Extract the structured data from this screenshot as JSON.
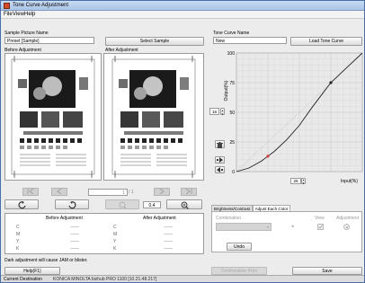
{
  "window": {
    "title": "Tone Curve Adjustment"
  },
  "menu": [
    "File",
    "View",
    "Help"
  ],
  "sample": {
    "label": "Sample Picture Name",
    "value": "Preset [Sample]",
    "select_button": "Select Sample"
  },
  "tonecurve": {
    "label": "Tone Curve Name",
    "value": "New",
    "load_button": "Load Tone Curve"
  },
  "before_label": "Before Adjustment",
  "after_label": "After Adjustment",
  "nav": {
    "page_value": "1",
    "page_total": "/ 1",
    "zoom": "0.4"
  },
  "table": {
    "before_header": "Before Adjustment",
    "after_header": "After Adjustment",
    "channels": [
      "C",
      "M",
      "Y",
      "K"
    ],
    "value": "------"
  },
  "warning": "Dark adjustment will cause JAM or blister.",
  "help_button": "Help(F1)",
  "graph": {
    "y_axis_label": "Output(%)",
    "x_axis_label": "Input(%)",
    "y_ticks": [
      "100",
      "75",
      "50",
      "25",
      "0"
    ],
    "x_ticks": [
      "0",
      "25",
      "50",
      "75",
      "100"
    ],
    "y_spin_value": "16",
    "x_spin_value": "25",
    "curve": [
      [
        0,
        0
      ],
      [
        10,
        3
      ],
      [
        20,
        9
      ],
      [
        25,
        13
      ],
      [
        30,
        17
      ],
      [
        40,
        27
      ],
      [
        50,
        39
      ],
      [
        60,
        54
      ],
      [
        70,
        68
      ],
      [
        75,
        75
      ],
      [
        80,
        80
      ],
      [
        90,
        90
      ],
      [
        100,
        100
      ]
    ],
    "points": [
      {
        "x": 25,
        "y": 13,
        "color": "#d43c3c"
      },
      {
        "x": 75,
        "y": 75,
        "color": "#222222"
      }
    ]
  },
  "adjust": {
    "tabs": [
      "Brightness/Contrast",
      "Adjust Each Color"
    ],
    "combination_label": "Combination",
    "view_label": "View",
    "adjustment_label": "Adjustment",
    "undo_button": "Undo"
  },
  "confirm_button": "Confirmation Print",
  "save_button": "Save",
  "status": {
    "label": "Current Destination",
    "value": "KONICA MINOLTA bizhub PRO 1100 [10.21.48.217]"
  }
}
